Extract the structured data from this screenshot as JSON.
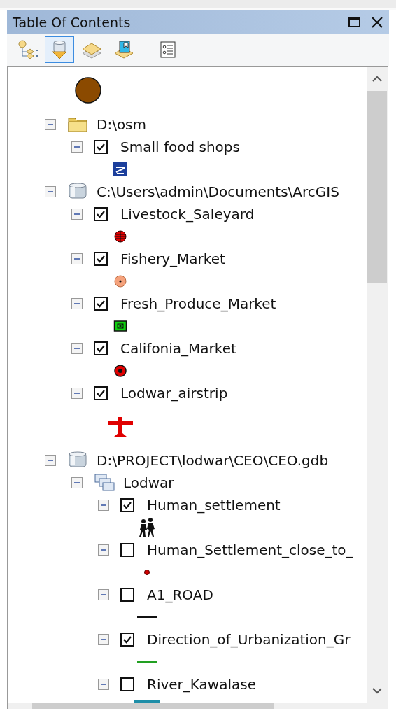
{
  "window": {
    "title": "Table Of Contents"
  },
  "toolbar": [
    {
      "kind": "drawing-order",
      "selected": false
    },
    {
      "kind": "source",
      "selected": true
    },
    {
      "kind": "visibility",
      "selected": false
    },
    {
      "kind": "selection",
      "selected": false
    },
    {
      "kind": "options",
      "selected": false
    }
  ],
  "tree": {
    "leading_symbol": {
      "kind": "brown-circle"
    },
    "items": [
      {
        "kind": "folder",
        "label": "D:\\osm",
        "expanded": true,
        "children": [
          {
            "kind": "layer",
            "label": "Small food shops",
            "checked": true,
            "expanded": true,
            "symbol": {
              "kind": "shop"
            }
          }
        ]
      },
      {
        "kind": "database",
        "label": "C:\\Users\\admin\\Documents\\ArcGIS",
        "expanded": true,
        "children": [
          {
            "kind": "layer",
            "label": "Livestock_Saleyard",
            "checked": true,
            "expanded": true,
            "symbol": {
              "kind": "red-grid-circle"
            }
          },
          {
            "kind": "layer",
            "label": "Fishery_Market",
            "checked": true,
            "expanded": true,
            "symbol": {
              "kind": "salmon-circle"
            }
          },
          {
            "kind": "layer",
            "label": "Fresh_Produce_Market",
            "checked": true,
            "expanded": true,
            "symbol": {
              "kind": "green-square"
            }
          },
          {
            "kind": "layer",
            "label": "Califonia_Market",
            "checked": true,
            "expanded": true,
            "symbol": {
              "kind": "red-ring"
            }
          },
          {
            "kind": "layer",
            "label": "Lodwar_airstrip",
            "checked": true,
            "expanded": true,
            "symbol": {
              "kind": "airplane"
            }
          }
        ]
      },
      {
        "kind": "database",
        "label": "D:\\PROJECT\\lodwar\\CEO\\CEO.gdb",
        "expanded": true,
        "children": [
          {
            "kind": "group",
            "label": "Lodwar",
            "expanded": true,
            "children": [
              {
                "kind": "layer",
                "label": "Human_settlement",
                "checked": true,
                "expanded": true,
                "symbol": {
                  "kind": "people"
                }
              },
              {
                "kind": "layer",
                "label": "Human_Settlement_close_to_",
                "checked": false,
                "expanded": true,
                "symbol": {
                  "kind": "red-dot"
                }
              },
              {
                "kind": "layer",
                "label": "A1_ROAD",
                "checked": false,
                "expanded": true,
                "symbol": {
                  "kind": "black-line"
                }
              },
              {
                "kind": "layer",
                "label": "Direction_of_Urbanization_Gr",
                "checked": true,
                "expanded": true,
                "symbol": {
                  "kind": "green-line"
                }
              },
              {
                "kind": "layer",
                "label": "River_Kawalase",
                "checked": false,
                "expanded": true,
                "symbol": {
                  "kind": "teal-line"
                }
              }
            ]
          }
        ]
      }
    ]
  }
}
